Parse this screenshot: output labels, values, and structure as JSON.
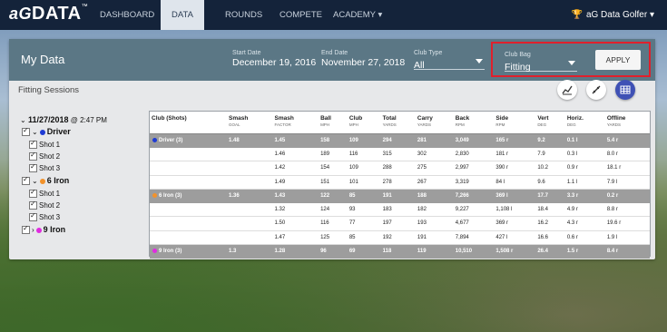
{
  "app": {
    "logo_ag": "aG",
    "logo_data": "DATA",
    "logo_tm": "™"
  },
  "nav": {
    "items": [
      {
        "label": "Dashboard",
        "active": false
      },
      {
        "label": "Data",
        "active": true
      },
      {
        "label": "Rounds",
        "active": false
      },
      {
        "label": "Compete",
        "active": false
      },
      {
        "label": "Academy ▾",
        "active": false
      }
    ],
    "user": "aG Data Golfer ▾"
  },
  "filter": {
    "title": "My Data",
    "start_label": "Start Date",
    "start_value": "December 19, 2016",
    "end_label": "End Date",
    "end_value": "November 27, 2018",
    "club_type_label": "Club Type",
    "club_type_value": "All",
    "club_bag_label": "Club Bag",
    "club_bag_value": "Fitting",
    "apply": "APPLY"
  },
  "sessions": {
    "title": "Fitting Sessions",
    "icons": [
      "line-chart-icon",
      "scatter-icon",
      "table-icon"
    ],
    "date": "11/27/2018",
    "time": "@ 2:47 PM",
    "tree": [
      {
        "label": "Driver",
        "color": "#1f3bd4",
        "shots": [
          "Shot 1",
          "Shot 2",
          "Shot 3"
        ]
      },
      {
        "label": "6 Iron",
        "color": "#f2922b",
        "shots": [
          "Shot 1",
          "Shot 2",
          "Shot 3"
        ]
      },
      {
        "label": "9 Iron",
        "color": "#e02be0",
        "shots": []
      }
    ]
  },
  "table": {
    "headers": [
      {
        "label": "Club (Shots)",
        "unit": ""
      },
      {
        "label": "Smash",
        "unit": "GOAL"
      },
      {
        "label": "Smash",
        "unit": "FACTOR"
      },
      {
        "label": "Ball",
        "unit": "MPH"
      },
      {
        "label": "Club",
        "unit": "MPH"
      },
      {
        "label": "Total",
        "unit": "YARDS"
      },
      {
        "label": "Carry",
        "unit": "YARDS"
      },
      {
        "label": "Back",
        "unit": "RPM"
      },
      {
        "label": "Side",
        "unit": "RPM"
      },
      {
        "label": "Vert",
        "unit": "DEG"
      },
      {
        "label": "Horiz.",
        "unit": "DEG"
      },
      {
        "label": "Offline",
        "unit": "YARDS"
      }
    ],
    "rows": [
      {
        "type": "club",
        "color": "#1f3bd4",
        "cells": [
          "Driver (3)",
          "1.48",
          "1.45",
          "158",
          "109",
          "294",
          "281",
          "3,049",
          "165 r",
          "9.2",
          "0.1 l",
          "5.4 r"
        ]
      },
      {
        "type": "shot",
        "cells": [
          "",
          "",
          "1.46",
          "189",
          "116",
          "315",
          "302",
          "2,830",
          "181 r",
          "7.9",
          "0.3 l",
          "8.0 r"
        ]
      },
      {
        "type": "shot",
        "cells": [
          "",
          "",
          "1.42",
          "154",
          "109",
          "288",
          "275",
          "2,997",
          "390 r",
          "10.2",
          "0.9 r",
          "18.1 r"
        ]
      },
      {
        "type": "shot",
        "cells": [
          "",
          "",
          "1.49",
          "151",
          "101",
          "278",
          "267",
          "3,319",
          "84 l",
          "9.6",
          "1.1 l",
          "7.9 l"
        ]
      },
      {
        "type": "club",
        "color": "#f2922b",
        "cells": [
          "6 Iron (3)",
          "1.36",
          "1.43",
          "122",
          "85",
          "191",
          "188",
          "7,266",
          "369 l",
          "17.7",
          "3.3 r",
          "0.2 r"
        ]
      },
      {
        "type": "shot",
        "cells": [
          "",
          "",
          "1.32",
          "124",
          "93",
          "183",
          "182",
          "9,227",
          "1,108 l",
          "18.4",
          "4.9 r",
          "8.8 r"
        ]
      },
      {
        "type": "shot",
        "cells": [
          "",
          "",
          "1.50",
          "116",
          "77",
          "197",
          "193",
          "4,677",
          "369 r",
          "16.2",
          "4.3 r",
          "19.6 r"
        ]
      },
      {
        "type": "shot",
        "cells": [
          "",
          "",
          "1.47",
          "125",
          "85",
          "192",
          "191",
          "7,894",
          "427 l",
          "16.6",
          "0.6 r",
          "1.9 l"
        ]
      },
      {
        "type": "club",
        "color": "#e02be0",
        "cells": [
          "9 Iron (3)",
          "1.3",
          "1.28",
          "96",
          "69",
          "118",
          "119",
          "10,510",
          "1,508 r",
          "26.4",
          "1.5 r",
          "8.4 r"
        ]
      }
    ]
  }
}
